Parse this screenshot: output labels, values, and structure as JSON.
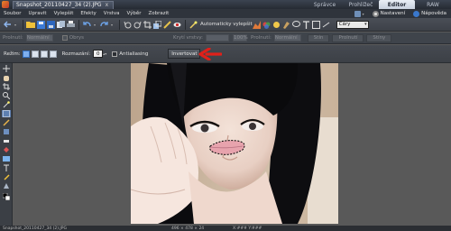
{
  "titlebar": {
    "document_tab": "Snapshot_20110427_34 (2).JPG",
    "close_glyph": "x",
    "modes": [
      {
        "label": "Správce"
      },
      {
        "label": "Prohlížeč"
      },
      {
        "label": "Editor"
      },
      {
        "label": "RAW"
      }
    ],
    "active_mode": "Editor"
  },
  "menubar": {
    "items": [
      {
        "label": "Soubor"
      },
      {
        "label": "Upravit"
      },
      {
        "label": "Vylepšit"
      },
      {
        "label": "Efekty"
      },
      {
        "label": "Vrstva"
      },
      {
        "label": "Výběr"
      },
      {
        "label": "Zobrazit"
      }
    ],
    "settings_label": "Nastavení",
    "help_label": "Nápověda"
  },
  "toolbar1": {
    "auto_enhance_label": "Automaticky vylepšit",
    "combo_value": "Čáry"
  },
  "toolbar2": {
    "label1": "Prolnutí:",
    "value1": "Normální",
    "label2": "Obrys",
    "label3": "Krytí vrstvy:",
    "value3": "100%",
    "label4": "Prolnutí:",
    "value4": "Normální",
    "buttons": [
      {
        "label": "Stín"
      },
      {
        "label": "Prolnutí"
      },
      {
        "label": "Stíny"
      }
    ]
  },
  "optbar": {
    "mode_label": "Režim:",
    "feather_label": "Rozmazání:",
    "feather_value": "0",
    "antialias_label": "Antialiasing",
    "antialias_checked": false,
    "invert_label": "Invertovat",
    "spin_glyph": "▴▾"
  },
  "status": {
    "file": "Snapshot_20110427_34 (2).JPG",
    "dimensions": "496 × 478 × 24",
    "coords": "X:### Y:###"
  },
  "colors": {
    "accent": "#3d78c8",
    "arrow": "#e0201a",
    "selection": "#000000"
  }
}
